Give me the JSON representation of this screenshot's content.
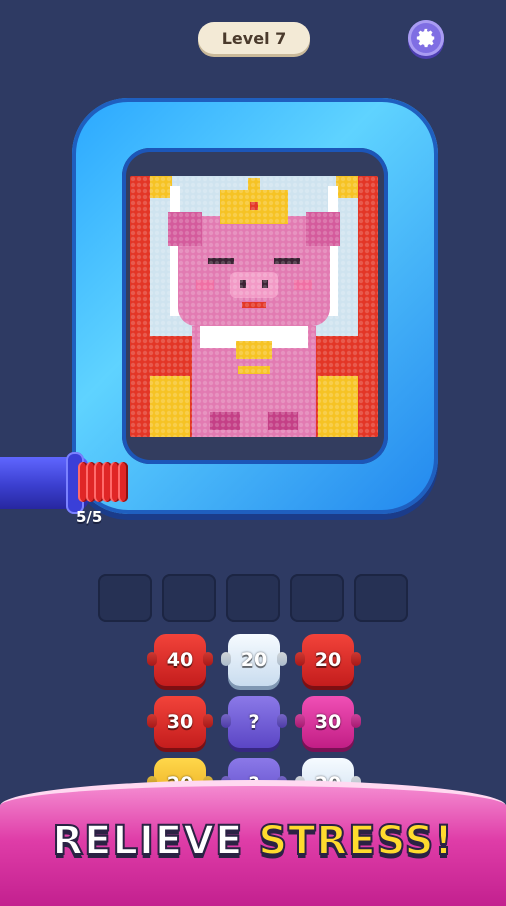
{
  "header": {
    "level_label": "Level 7",
    "settings_icon": "gear-icon"
  },
  "board": {
    "progress_text": "5/5",
    "picture_subject": "pig wearing a gold crown"
  },
  "tray": {
    "slot_count": 5
  },
  "tokens": [
    {
      "value": "40",
      "color": "red"
    },
    {
      "value": "20",
      "color": "white"
    },
    {
      "value": "20",
      "color": "red"
    },
    {
      "value": "30",
      "color": "red"
    },
    {
      "value": "?",
      "color": "purple"
    },
    {
      "value": "30",
      "color": "pink"
    },
    {
      "value": "20",
      "color": "yellow"
    },
    {
      "value": "?",
      "color": "purple"
    },
    {
      "value": "20",
      "color": "white"
    }
  ],
  "banner": {
    "word1": "RELIEVE",
    "word2": "STRESS!"
  },
  "colors": {
    "background": "#2e3a63",
    "frame_blue": "#2aa7ff",
    "banner_pink": "#df3da8",
    "accent_yellow": "#ffdb2e"
  }
}
